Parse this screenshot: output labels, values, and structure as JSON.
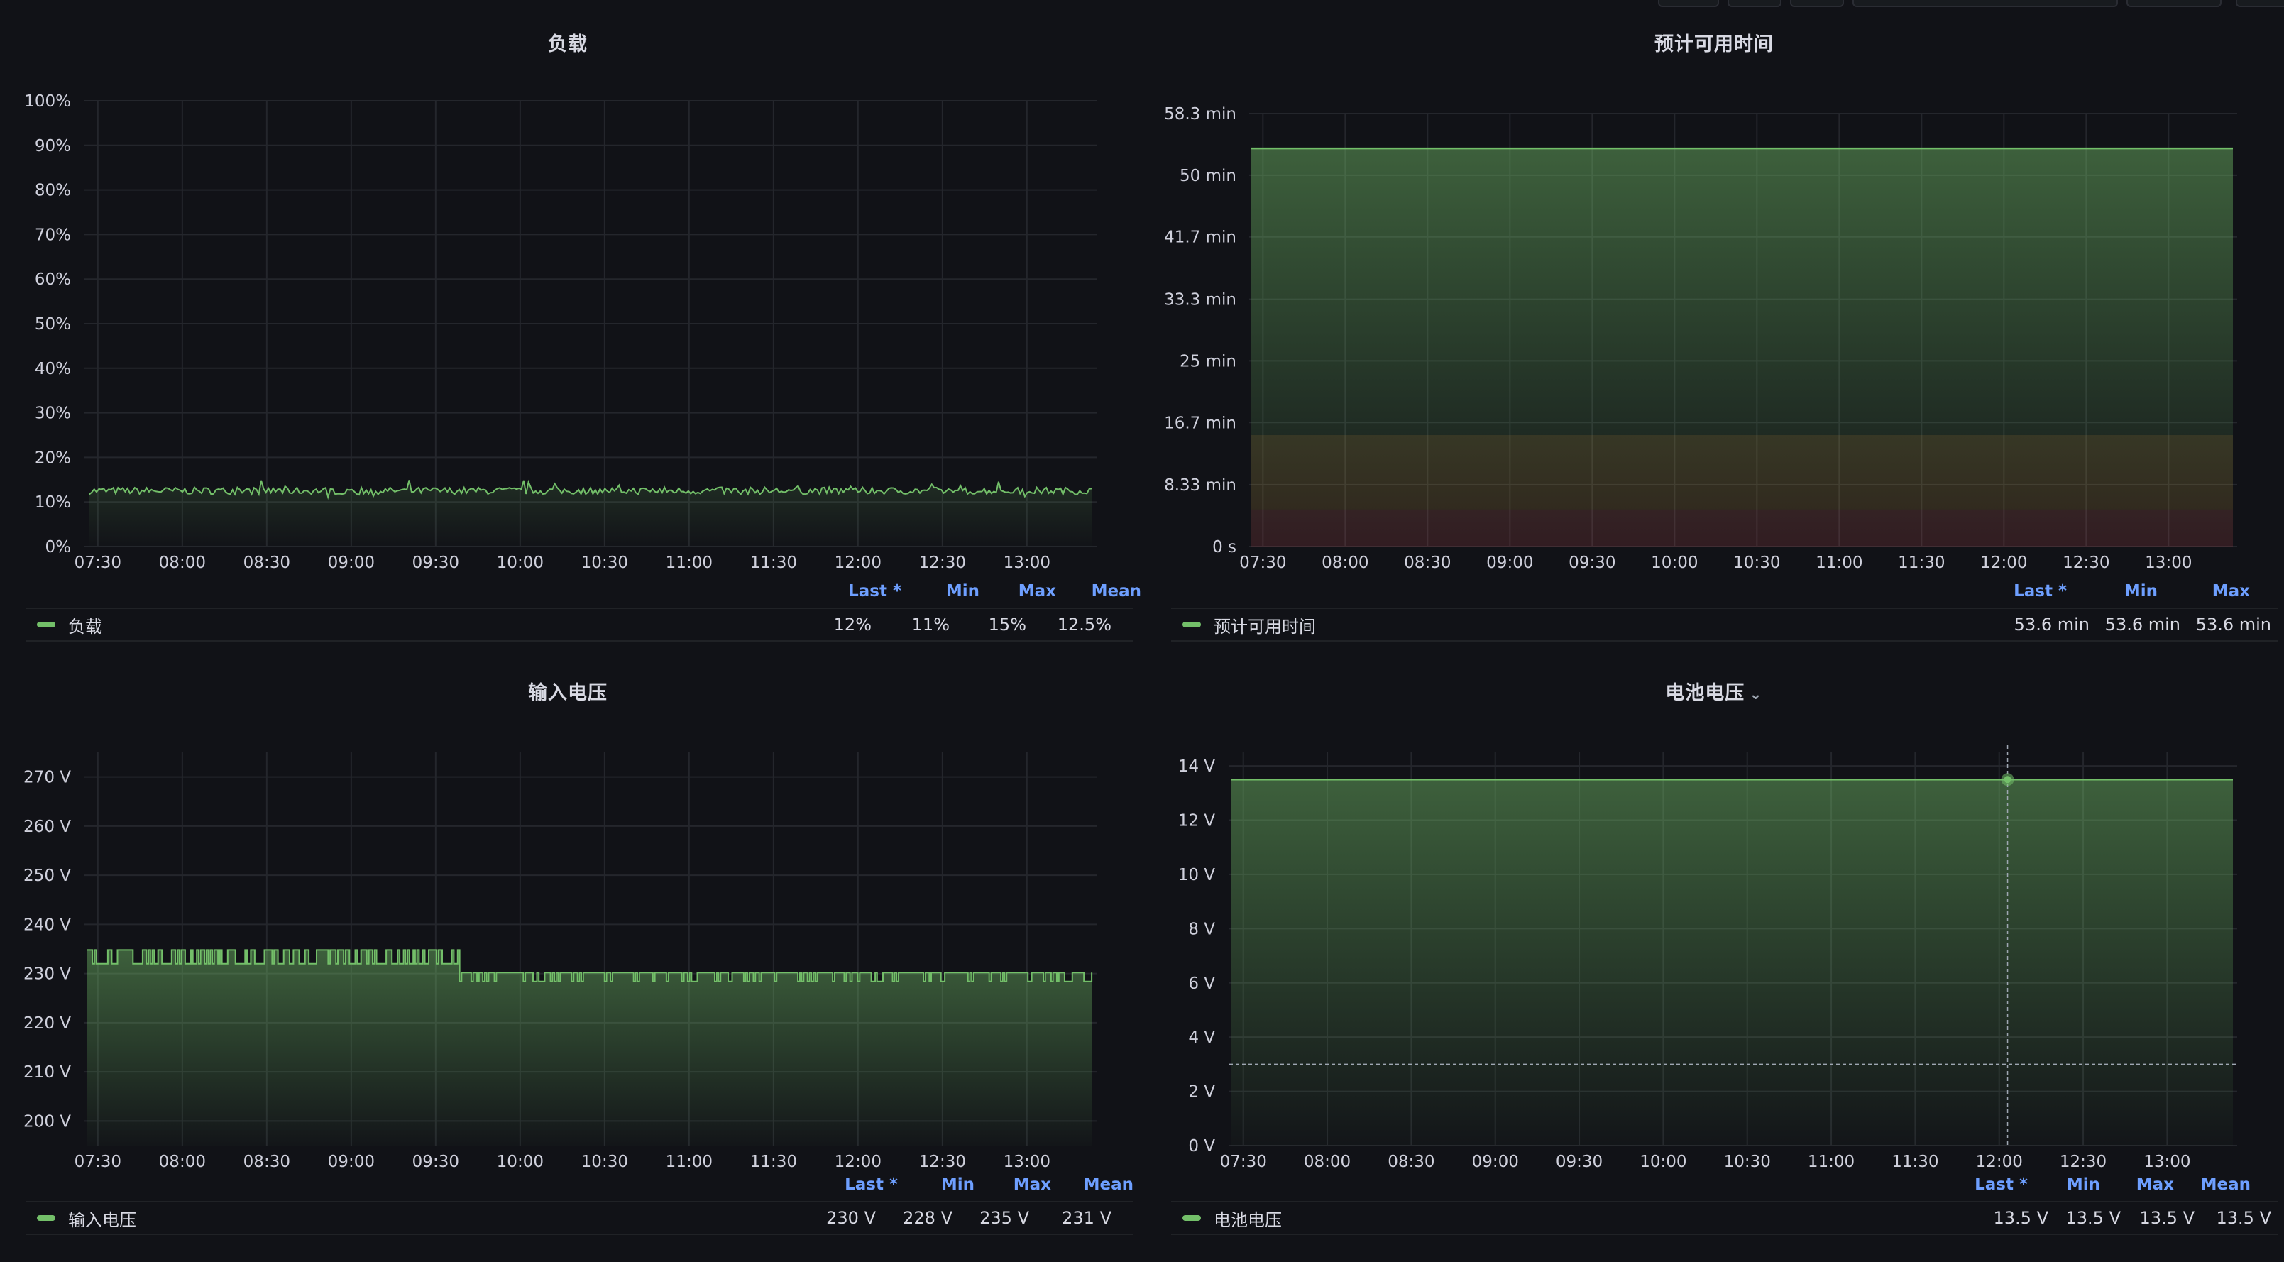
{
  "panels": [
    {
      "title": "负载",
      "series_name": "负载",
      "legend_headers": [
        "Last *",
        "Min",
        "Max",
        "Mean"
      ],
      "legend_values": [
        "12%",
        "11%",
        "15%",
        "12.5%"
      ],
      "color": "#73bf69"
    },
    {
      "title": "预计可用时间",
      "series_name": "预计可用时间",
      "legend_headers": [
        "Last *",
        "Min",
        "Max"
      ],
      "legend_values": [
        "53.6 min",
        "53.6 min",
        "53.6 min"
      ],
      "color": "#73bf69"
    },
    {
      "title": "输入电压",
      "series_name": "输入电压",
      "legend_headers": [
        "Last *",
        "Min",
        "Max",
        "Mean"
      ],
      "legend_values": [
        "230 V",
        "228 V",
        "235 V",
        "231 V"
      ],
      "color": "#73bf69"
    },
    {
      "title": "电池电压",
      "title_menu_icon": "chevron-down-icon",
      "series_name": "电池电压",
      "legend_headers": [
        "Last *",
        "Min",
        "Max",
        "Mean"
      ],
      "legend_values": [
        "13.5 V",
        "13.5 V",
        "13.5 V",
        "13.5 V"
      ],
      "color": "#73bf69"
    }
  ],
  "chart_data": [
    {
      "type": "line",
      "title": "负载",
      "x_ticks": [
        "07:30",
        "08:00",
        "08:30",
        "09:00",
        "09:30",
        "10:00",
        "10:30",
        "11:00",
        "11:30",
        "12:00",
        "12:30",
        "13:00"
      ],
      "x_range": [
        "07:25",
        "13:25"
      ],
      "y_ticks": [
        "0%",
        "10%",
        "20%",
        "30%",
        "40%",
        "50%",
        "60%",
        "70%",
        "80%",
        "90%",
        "100%"
      ],
      "ylim": [
        0,
        100
      ],
      "grid": true,
      "series": [
        {
          "name": "负载",
          "min": 11,
          "max": 15,
          "mean": 12.5,
          "last": 12
        }
      ]
    },
    {
      "type": "area",
      "title": "预计可用时间",
      "x_ticks": [
        "07:30",
        "08:00",
        "08:30",
        "09:00",
        "09:30",
        "10:00",
        "10:30",
        "11:00",
        "11:30",
        "12:00",
        "12:30",
        "13:00"
      ],
      "x_range": [
        "07:25",
        "13:25"
      ],
      "y_ticks": [
        "0 s",
        "8.33 min",
        "16.7 min",
        "25 min",
        "33.3 min",
        "41.7 min",
        "50 min",
        "58.3 min"
      ],
      "ylim": [
        0,
        58.3
      ],
      "grid": true,
      "thresholds": [
        {
          "to": 5,
          "color": "#f2495c"
        },
        {
          "to": 15,
          "color": "#ff9830"
        }
      ],
      "series": [
        {
          "name": "预计可用时间",
          "value": 53.6
        }
      ]
    },
    {
      "type": "area",
      "title": "输入电压",
      "x_ticks": [
        "07:30",
        "08:00",
        "08:30",
        "09:00",
        "09:30",
        "10:00",
        "10:30",
        "11:00",
        "11:30",
        "12:00",
        "12:30",
        "13:00"
      ],
      "x_range": [
        "07:25",
        "13:25"
      ],
      "y_ticks": [
        "200 V",
        "210 V",
        "220 V",
        "230 V",
        "240 V",
        "250 V",
        "260 V",
        "270 V"
      ],
      "ylim": [
        195,
        275
      ],
      "grid": true,
      "series": [
        {
          "name": "输入电压",
          "min": 228,
          "max": 235,
          "mean": 231,
          "last": 230,
          "step_down_at": "09:38"
        }
      ]
    },
    {
      "type": "area",
      "title": "电池电压",
      "x_ticks": [
        "07:30",
        "08:00",
        "08:30",
        "09:00",
        "09:30",
        "10:00",
        "10:30",
        "11:00",
        "11:30",
        "12:00",
        "12:30",
        "13:00"
      ],
      "x_range": [
        "07:25",
        "13:25"
      ],
      "y_ticks": [
        "0 V",
        "2 V",
        "4 V",
        "6 V",
        "8 V",
        "10 V",
        "12 V",
        "14 V"
      ],
      "ylim": [
        0,
        14.5
      ],
      "grid": true,
      "crosshair": {
        "x": "12:03",
        "y": 3
      },
      "series": [
        {
          "name": "电池电压",
          "value": 13.5
        }
      ]
    }
  ]
}
